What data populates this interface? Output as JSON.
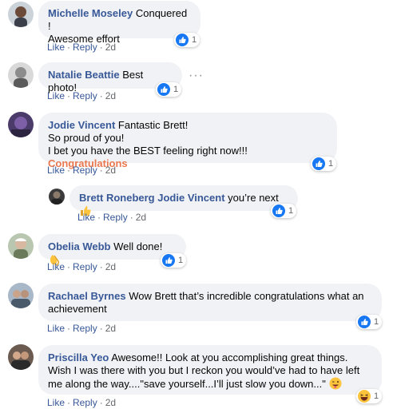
{
  "comments": [
    {
      "author": "Michelle Moseley",
      "text_line1": "Conquered !",
      "text_line2": "Awesome effort",
      "actions": {
        "like": "Like",
        "reply": "Reply",
        "time": "2d"
      },
      "reaction": {
        "type": "like",
        "count": "1"
      }
    },
    {
      "author": "Natalie Beattie",
      "text": "Best photo!",
      "more": "···",
      "actions": {
        "like": "Like",
        "reply": "Reply",
        "time": "2d"
      },
      "reaction": {
        "type": "like",
        "count": "1"
      }
    },
    {
      "author": "Jodie Vincent",
      "text_line1": "Fantastic Brett!",
      "text_line2": "So proud of you!",
      "text_line3": "I bet you have the BEST feeling right now!!!",
      "highlight": "Congratulations",
      "actions": {
        "like": "Like",
        "reply": "Reply",
        "time": "2d"
      },
      "reaction": {
        "type": "like",
        "count": "1"
      }
    },
    {
      "author": "Brett Roneberg",
      "mention": "Jodie Vincent",
      "text": "you’re next",
      "actions": {
        "like": "Like",
        "reply": "Reply",
        "time": "2d"
      },
      "reaction": {
        "type": "like",
        "count": "1"
      }
    },
    {
      "author": "Obelia Webb",
      "text": "Well done!",
      "actions": {
        "like": "Like",
        "reply": "Reply",
        "time": "2d"
      },
      "reaction": {
        "type": "like",
        "count": "1"
      }
    },
    {
      "author": "Rachael Byrnes",
      "text_line1": "Wow Brett that’s incredible congratulations what an",
      "text_line2": "achievement",
      "actions": {
        "like": "Like",
        "reply": "Reply",
        "time": "2d"
      },
      "reaction": {
        "type": "like",
        "count": "1"
      }
    },
    {
      "author": "Priscilla Yeo",
      "text_line1": "Awesome!! Look at you accomplishing great things.",
      "text_line2": "Wish I was there with you but I reckon you would’ve had to have left",
      "text_line3": "me along the way....\"save yourself...I’ll just slow you down...\"",
      "actions": {
        "like": "Like",
        "reply": "Reply",
        "time": "2d"
      },
      "reaction": {
        "type": "haha",
        "count": "1"
      }
    }
  ],
  "colors": {
    "link": "#385898",
    "bubble": "#f0f2f5",
    "meta": "#65676b",
    "like_blue": "#1877f2",
    "highlight": "#e9774f"
  }
}
